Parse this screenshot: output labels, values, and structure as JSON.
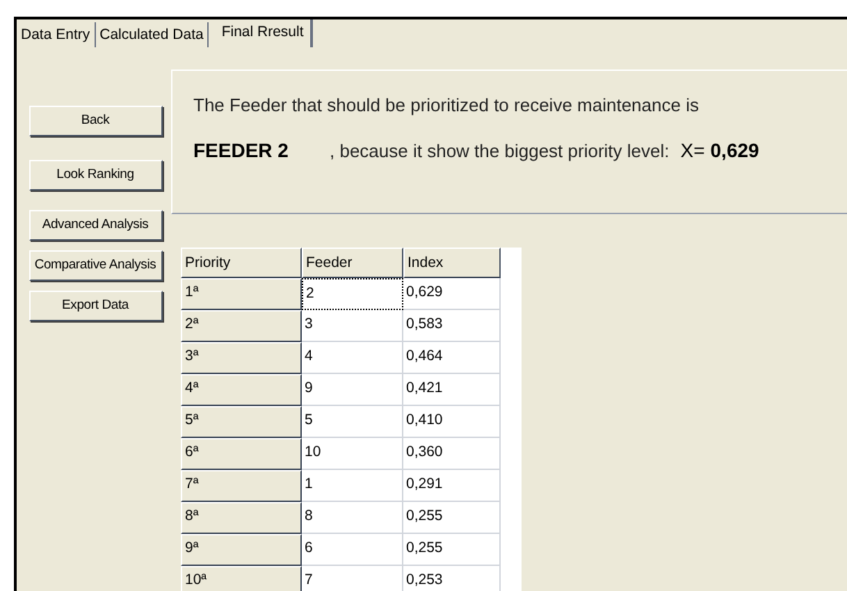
{
  "tabs": [
    {
      "label": "Data Entry",
      "selected": false
    },
    {
      "label": "Calculated Data",
      "selected": false
    },
    {
      "label": "Final Rresult",
      "selected": true
    }
  ],
  "message": {
    "line_1": "The Feeder that should be prioritized to receive maintenance is",
    "feeder": "FEEDER 2",
    "reason": ", because it show the biggest priority level:",
    "x_label": "X=",
    "x_value": "0,629"
  },
  "buttons": [
    "Back",
    "Look Ranking",
    "Advanced Analysis",
    "Comparative Analysis",
    "Export Data"
  ],
  "table": {
    "columns": [
      "Priority",
      "Feeder",
      "Index"
    ],
    "rows": [
      {
        "priority": "1ª",
        "feeder": "2",
        "index": "0,629",
        "selected": true
      },
      {
        "priority": "2ª",
        "feeder": "3",
        "index": "0,583",
        "selected": false
      },
      {
        "priority": "3ª",
        "feeder": "4",
        "index": "0,464",
        "selected": false
      },
      {
        "priority": "4ª",
        "feeder": "9",
        "index": "0,421",
        "selected": false
      },
      {
        "priority": "5ª",
        "feeder": "5",
        "index": "0,410",
        "selected": false
      },
      {
        "priority": "6ª",
        "feeder": "10",
        "index": "0,360",
        "selected": false
      },
      {
        "priority": "7ª",
        "feeder": "1",
        "index": "0,291",
        "selected": false
      },
      {
        "priority": "8ª",
        "feeder": "8",
        "index": "0,255",
        "selected": false
      },
      {
        "priority": "9ª",
        "feeder": "6",
        "index": "0,255",
        "selected": false
      },
      {
        "priority": "10ª",
        "feeder": "7",
        "index": "0,253",
        "selected": false
      }
    ]
  }
}
